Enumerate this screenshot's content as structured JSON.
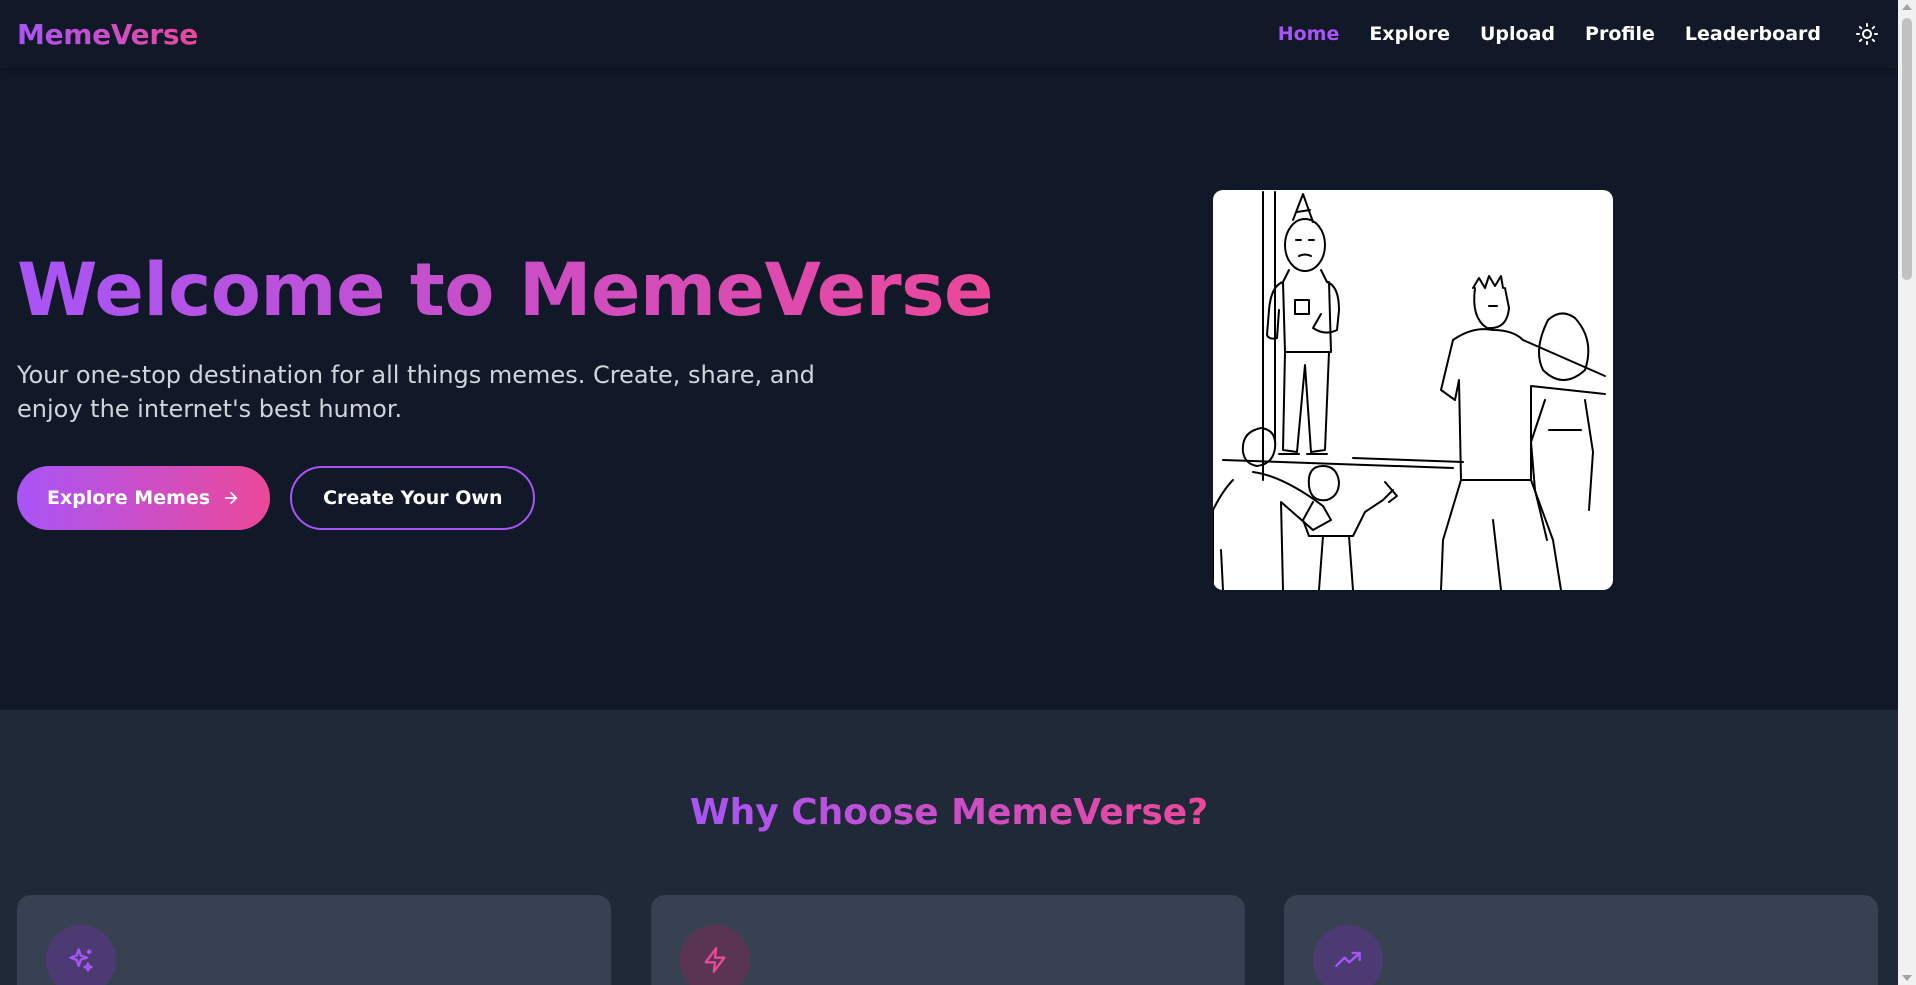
{
  "nav": {
    "brand": "MemeVerse",
    "links": [
      {
        "label": "Home",
        "active": true
      },
      {
        "label": "Explore",
        "active": false
      },
      {
        "label": "Upload",
        "active": false
      },
      {
        "label": "Profile",
        "active": false
      },
      {
        "label": "Leaderboard",
        "active": false
      }
    ],
    "theme_icon": "sun-icon"
  },
  "hero": {
    "title": "Welcome to MemeVerse",
    "subtitle": "Your one-stop destination for all things memes. Create, share, and enjoy the internet's best humor.",
    "primary_button": "Explore Memes",
    "secondary_button": "Create Your Own",
    "image_icon": "meme-image"
  },
  "features": {
    "title": "Why Choose MemeVerse?",
    "cards": [
      {
        "icon": "sparkles-icon"
      },
      {
        "icon": "lightning-icon"
      },
      {
        "icon": "trending-up-icon"
      }
    ]
  },
  "colors": {
    "accent_purple": "#a855f7",
    "accent_pink": "#ec4899",
    "background": "#111827",
    "section_background": "#1f2937",
    "card_background": "#374151"
  }
}
